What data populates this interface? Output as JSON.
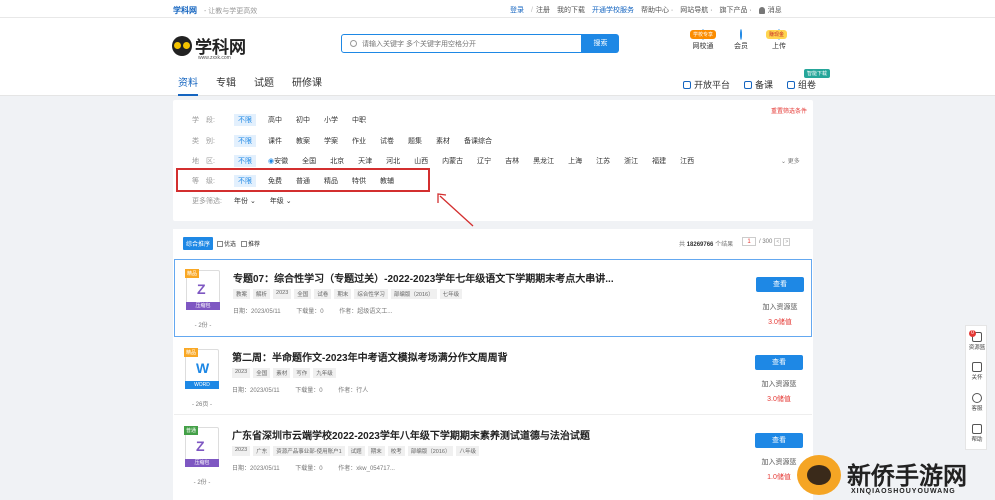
{
  "topbar": {
    "brand": "学科网",
    "slogan": "- 让教与学更高效",
    "login": "登录",
    "register": "注册",
    "my_downloads": "我的下载",
    "open_school_service": "开通学校服务",
    "help_center": "帮助中心 ·",
    "site_nav": "网站导航 ·",
    "products": "旗下产品 ·",
    "messages": "消息"
  },
  "logo": {
    "name": "学科网",
    "url": "www.zxxk.com"
  },
  "search": {
    "placeholder": "请输入关键字 多个关键字用空格分开",
    "button": "搜索"
  },
  "header_icons": [
    {
      "label": "网校通",
      "bubble": "学校专享"
    },
    {
      "label": "会员",
      "bubble": ""
    },
    {
      "label": "上传",
      "bubble": "赚现金"
    }
  ],
  "nav_tabs": [
    "资料",
    "专辑",
    "试题",
    "研修课"
  ],
  "right_nav": {
    "open_platform": "开放平台",
    "lesson_prep": "备课",
    "compose": "组卷",
    "compose_badge": "智能下载"
  },
  "filters": {
    "reset": "重置筛选条件",
    "more": "更多",
    "rows": [
      {
        "label": "学　段:",
        "options": [
          "不限",
          "高中",
          "初中",
          "小学",
          "中职"
        ]
      },
      {
        "label": "类　别:",
        "options": [
          "不限",
          "课件",
          "教案",
          "学案",
          "作业",
          "试卷",
          "题集",
          "素材",
          "备课综合"
        ]
      },
      {
        "label": "地　区:",
        "options": [
          "不限",
          "安徽",
          "全国",
          "北京",
          "天津",
          "河北",
          "山西",
          "内蒙古",
          "辽宁",
          "吉林",
          "黑龙江",
          "上海",
          "江苏",
          "浙江",
          "福建",
          "江西"
        ]
      },
      {
        "label": "等　级:",
        "options": [
          "不限",
          "免费",
          "普通",
          "精品",
          "特供",
          "教辅"
        ]
      }
    ],
    "more_filters_label": "更多筛选:",
    "year": "年份",
    "grade": "年级"
  },
  "results": {
    "sort_label": "综合推序",
    "optimal": "优选",
    "recommend": "推荐",
    "total_prefix": "共",
    "total": "18269766",
    "total_suffix": "个结果",
    "page_current": "1",
    "page_total": "/ 300",
    "prev": "<",
    "next": ">"
  },
  "cards": [
    {
      "badge": "精品",
      "type_label": "压缩包",
      "type_color": "#7e57c2",
      "mark": "Z",
      "pages": "- 2份 -",
      "title": "专题07：综合性学习（专题过关）-2022-2023学年七年级语文下学期期末考点大串讲...",
      "tags": [
        "教案",
        "解析",
        "2023",
        "全国",
        "试卷",
        "期末",
        "综合性学习",
        "部编版（2016）",
        "七年级"
      ],
      "date": "日期：2023/05/11",
      "downloads": "下载量：0",
      "author": "作者：超级语文工...",
      "view": "查看",
      "add": "加入资源篮",
      "price": "3.0储值"
    },
    {
      "badge": "精品",
      "type_label": "WORD",
      "type_color": "#1e88e5",
      "mark": "W",
      "pages": "- 26页 -",
      "title": "第二周：半命题作文-2023年中考语文模拟考场满分作文周周背",
      "tags": [
        "2023",
        "全国",
        "素材",
        "写作",
        "九年级"
      ],
      "date": "日期：2023/05/11",
      "downloads": "下载量：0",
      "author": "作者：行人",
      "view": "查看",
      "add": "加入资源篮",
      "price": "3.0储值"
    },
    {
      "badge": "普通",
      "type_label": "压缩包",
      "type_color": "#7e57c2",
      "mark": "Z",
      "pages": "- 2份 -",
      "title": "广东省深圳市云端学校2022-2023学年八年级下学期期末素养测试道德与法治试题",
      "tags": [
        "",
        "2023",
        "广东",
        "资源产品事业部-使用账户1",
        "试题",
        "期末",
        "校考",
        "部编版（2016）",
        "八年级"
      ],
      "date": "日期：2023/05/11",
      "downloads": "下载量：0",
      "author": "作者：xkw_054717...",
      "view": "查看",
      "add": "加入资源篮",
      "price": "1.0储值"
    }
  ],
  "side_panel": [
    {
      "label": "资源篮",
      "count": "0"
    },
    {
      "label": "关怀",
      "count": ""
    },
    {
      "label": "客服",
      "count": ""
    },
    {
      "label": "帮助",
      "count": ""
    }
  ],
  "watermark": {
    "text": "新侨手游网",
    "sub": "XINQIAOSHOUYOUWANG"
  },
  "colors": {
    "accent": "#1e88e5",
    "highlight": "#d32f2f",
    "price": "#e53935"
  }
}
